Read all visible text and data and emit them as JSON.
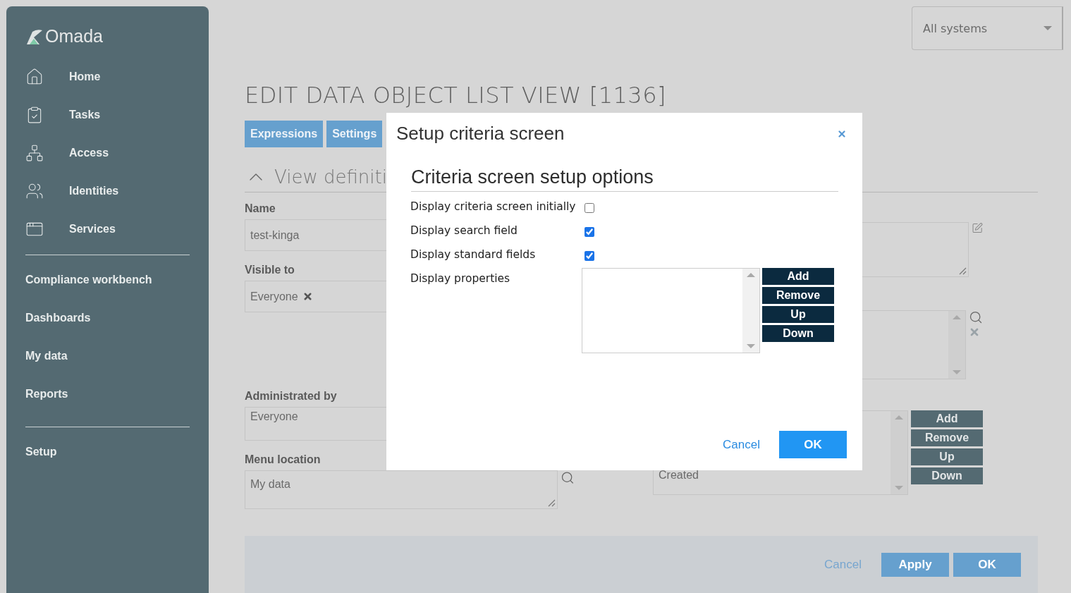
{
  "brand": {
    "name": "Omada"
  },
  "sidebar": {
    "groups": [
      {
        "items": [
          {
            "label": "Home"
          },
          {
            "label": "Tasks"
          },
          {
            "label": "Access"
          },
          {
            "label": "Identities"
          },
          {
            "label": "Services"
          }
        ]
      },
      {
        "items": [
          {
            "label": "Compliance workbench"
          },
          {
            "label": "Dashboards"
          },
          {
            "label": "My data"
          },
          {
            "label": "Reports"
          }
        ]
      },
      {
        "items": [
          {
            "label": "Setup"
          }
        ]
      }
    ]
  },
  "system_selector": {
    "value": "All systems"
  },
  "page": {
    "title": "EDIT DATA OBJECT LIST VIEW [1136]",
    "tabs": [
      {
        "label": "Expressions"
      },
      {
        "label": "Settings"
      }
    ],
    "section": {
      "title": "View definiti",
      "expanded": true
    },
    "fields_left": [
      {
        "kind": "input",
        "label": "Name",
        "value": "test-kinga"
      },
      {
        "kind": "tags",
        "label": "Visible to",
        "tags": [
          "Everyone"
        ]
      },
      {
        "kind": "textarea",
        "label": "Administrated by",
        "value": "Everyone"
      },
      {
        "kind": "lookup",
        "label": "Menu location",
        "value": "My data"
      }
    ],
    "fields_right": [
      {
        "kind": "note"
      },
      {
        "kind": "picker"
      },
      {
        "kind": "list",
        "items": [
          "Created"
        ],
        "buttons": [
          "Add",
          "Remove",
          "Up",
          "Down"
        ]
      }
    ],
    "footer": {
      "buttons": [
        {
          "kind": "link",
          "label": "Cancel"
        },
        {
          "kind": "primary",
          "label": "Apply"
        },
        {
          "kind": "primary",
          "label": "OK"
        }
      ]
    }
  },
  "dialog": {
    "title": "Setup criteria screen",
    "heading": "Criteria screen setup options",
    "options": [
      {
        "kind": "checkbox",
        "label": "Display criteria screen initially",
        "checked": false
      },
      {
        "kind": "checkbox",
        "label": "Display search field",
        "checked": true
      },
      {
        "kind": "checkbox",
        "label": "Display standard fields",
        "checked": true
      },
      {
        "kind": "list",
        "label": "Display properties",
        "buttons": [
          "Add",
          "Remove",
          "Up",
          "Down"
        ]
      }
    ],
    "buttons": [
      {
        "kind": "link",
        "label": "Cancel"
      },
      {
        "kind": "primary",
        "label": "OK"
      }
    ]
  }
}
